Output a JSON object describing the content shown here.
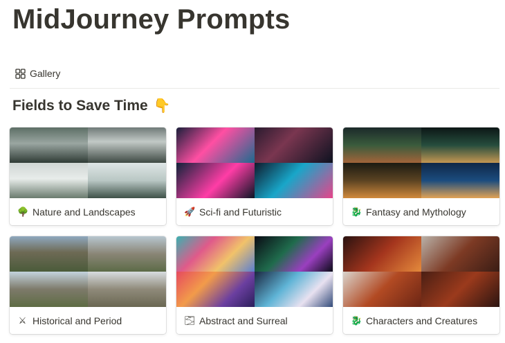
{
  "page": {
    "title": "MidJourney Prompts"
  },
  "view_tab": {
    "label": "Gallery",
    "icon": "gallery-grid-icon"
  },
  "section": {
    "title": "Fields to Save Time",
    "emoji": "👇"
  },
  "cards": [
    {
      "label": "Nature and Landscapes",
      "icon": "🌳",
      "icon_name": "tree-icon",
      "tiles": [
        "linear-gradient(180deg,#5d6f66 0%,#9aa6a1 45%,#2f3b35 100%)",
        "linear-gradient(180deg,#6f7a78 0%,#c2c9c6 40%,#3f4a44 100%)",
        "linear-gradient(180deg,#cfd6d3 0%,#e8ecea 45%,#6a7b6e 100%)",
        "linear-gradient(180deg,#dfe6e6 0%,#b9c7c4 50%,#3e5148 100%)"
      ]
    },
    {
      "label": "Sci-fi and Futuristic",
      "icon": "🚀",
      "icon_name": "rocket-icon",
      "tiles": [
        "linear-gradient(135deg,#1a1f3b 0%,#ff4fa3 45%,#1c6b8f 100%)",
        "linear-gradient(135deg,#2a1b2f 0%,#7a3650 40%,#0d1220 100%)",
        "linear-gradient(135deg,#10233a 0%,#ff3da6 55%,#0a1524 100%)",
        "linear-gradient(135deg,#0f1a2b 0%,#18a6c9 45%,#e7448a 100%)"
      ]
    },
    {
      "label": "Fantasy and Mythology",
      "icon": "🐉",
      "icon_name": "dragon-icon",
      "tiles": [
        "linear-gradient(180deg,#1b2a2a 0%,#3a5b3c 50%,#a2643a 100%)",
        "linear-gradient(180deg,#0c1716 0%,#264d3d 50%,#c49752 100%)",
        "linear-gradient(180deg,#1c1a12 0%,#5b4322 50%,#d18a3b 100%)",
        "linear-gradient(180deg,#0f2747 0%,#1b4c7e 50%,#e1a355 100%)"
      ]
    },
    {
      "label": "Historical and Period",
      "icon": "⚔",
      "icon_name": "crossed-swords-icon",
      "tiles": [
        "linear-gradient(180deg,#8fa8bf 0%,#6e6a55 45%,#4a5b3a 100%)",
        "linear-gradient(180deg,#b7c6cf 0%,#8a8576 50%,#5c6b47 100%)",
        "linear-gradient(180deg,#c3d3de 0%,#7d7a6a 50%,#5e6c44 100%)",
        "linear-gradient(180deg,#d8dde0 0%,#8f8a7a 50%,#6a6752 100%)"
      ]
    },
    {
      "label": "Abstract and Surreal",
      "icon": "🌫",
      "icon_name": "fog-icon",
      "tiles": [
        "linear-gradient(135deg,#3bb0b0 0%,#e05a8a 35%,#f1c26a 65%,#5b7fd1 100%)",
        "linear-gradient(135deg,#0a0a14 0%,#1f6b4c 40%,#9a3fbf 70%,#0b0b18 100%)",
        "linear-gradient(135deg,#e64a5f 0%,#f29b4a 35%,#6b3fa0 70%,#2b1e5a 100%)",
        "linear-gradient(135deg,#1a2740 0%,#5fb4d6 40%,#e8e1f0 70%,#334b7a 100%)"
      ]
    },
    {
      "label": "Characters and Creatures",
      "icon": "🐉",
      "icon_name": "dragon-icon",
      "tiles": [
        "linear-gradient(135deg,#2a1210 0%,#a4351d 50%,#e48a3c 100%)",
        "linear-gradient(135deg,#b9b1a8 0%,#7d3a24 50%,#3a1d15 100%)",
        "linear-gradient(135deg,#d9d3cc 0%,#b24a23 50%,#6b2514 100%)",
        "linear-gradient(135deg,#4a1f14 0%,#9b3a1c 50%,#2b1511 100%)"
      ]
    }
  ]
}
